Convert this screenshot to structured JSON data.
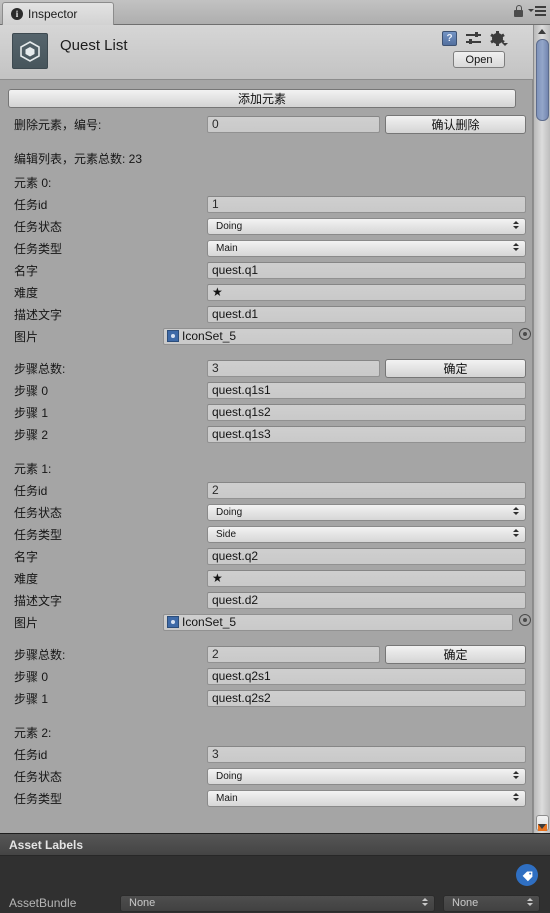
{
  "window": {
    "tab_label": "Inspector",
    "tab_icon": "info-icon",
    "lock_icon": "lock-icon",
    "menu_icon": "hamburger-menu-icon"
  },
  "header": {
    "asset_icon": "unity-logo-icon",
    "title": "Quest List",
    "help_icon": "help-book-icon",
    "help_glyph": "?",
    "preset_icon": "preset-sliders-icon",
    "gear_icon": "gear-icon",
    "open_label": "Open"
  },
  "toolbar": {
    "add_element_label": "添加元素",
    "delete_label": "删除元素，编号:",
    "delete_index_value": "0",
    "confirm_delete_label": "确认删除",
    "list_summary": "编辑列表，元素总数: 23"
  },
  "fields": {
    "id_label": "任务id",
    "state_label": "任务状态",
    "type_label": "任务类型",
    "name_label": "名字",
    "difficulty_label": "难度",
    "desc_label": "描述文字",
    "image_label": "图片",
    "steps_total_label": "步骤总数:",
    "confirm_label": "确定",
    "step_label": "步骤"
  },
  "elements": [
    {
      "header": "元素 0:",
      "id": "1",
      "state": "Doing",
      "type": "Main",
      "name": "quest.q1",
      "difficulty": "★",
      "description": "quest.d1",
      "image": "IconSet_5",
      "steps_total": "3",
      "steps": [
        {
          "label": "步骤 0",
          "value": "quest.q1s1"
        },
        {
          "label": "步骤 1",
          "value": "quest.q1s2"
        },
        {
          "label": "步骤 2",
          "value": "quest.q1s3"
        }
      ]
    },
    {
      "header": "元素 1:",
      "id": "2",
      "state": "Doing",
      "type": "Side",
      "name": "quest.q2",
      "difficulty": "★",
      "description": "quest.d2",
      "image": "IconSet_5",
      "steps_total": "2",
      "steps": [
        {
          "label": "步骤 0",
          "value": "quest.q2s1"
        },
        {
          "label": "步骤 1",
          "value": "quest.q2s2"
        }
      ]
    },
    {
      "header": "元素 2:",
      "id": "3",
      "state": "Doing",
      "type": "Main",
      "name": "",
      "difficulty": "",
      "description": "",
      "image": "",
      "steps_total": "",
      "steps": []
    }
  ],
  "footer": {
    "asset_labels_title": "Asset Labels",
    "tag_icon": "tag-icon",
    "assetbundle_label": "AssetBundle",
    "assetbundle_value": "None",
    "assetbundle_variant_value": "None"
  }
}
